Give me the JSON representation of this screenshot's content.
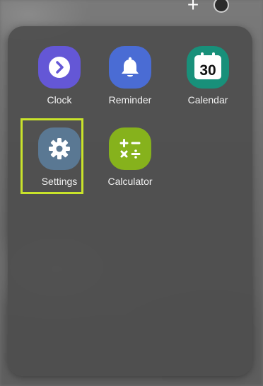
{
  "top_bar": {
    "add_icon": "plus-icon",
    "menu_icon": "more-dot-icon"
  },
  "apps": [
    {
      "id": "clock",
      "label": "Clock",
      "color": "#6457d6",
      "icon": "chevron-right-icon"
    },
    {
      "id": "reminder",
      "label": "Reminder",
      "color": "#4a6cd4",
      "icon": "bell-icon"
    },
    {
      "id": "calendar",
      "label": "Calendar",
      "color": "#18907a",
      "icon": "calendar-icon",
      "day": "30"
    },
    {
      "id": "settings",
      "label": "Settings",
      "color": "#5a7893",
      "icon": "gear-icon"
    },
    {
      "id": "calculator",
      "label": "Calculator",
      "color": "#86b21c",
      "icon": "calculator-icon"
    }
  ],
  "highlight_color": "#c9e32b"
}
